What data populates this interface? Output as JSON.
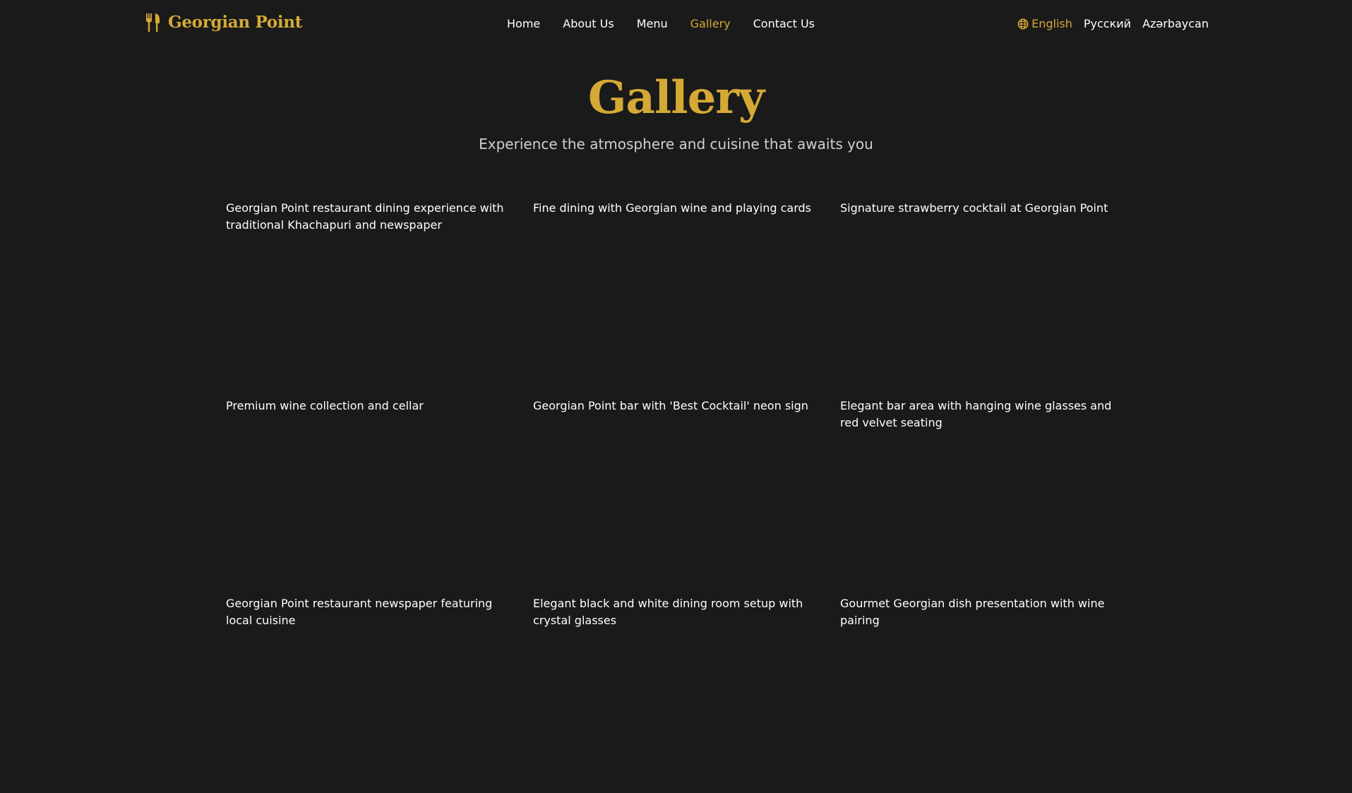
{
  "brand": {
    "name": "Georgian Point",
    "accent_color": "#d4a935",
    "icon": "fork-knife-icon"
  },
  "nav": {
    "items": [
      {
        "label": "Home",
        "active": false
      },
      {
        "label": "About Us",
        "active": false
      },
      {
        "label": "Menu",
        "active": false
      },
      {
        "label": "Gallery",
        "active": true
      },
      {
        "label": "Contact Us",
        "active": false
      }
    ]
  },
  "languages": {
    "icon": "globe-icon",
    "items": [
      {
        "label": "English",
        "active": true
      },
      {
        "label": "Русский",
        "active": false
      },
      {
        "label": "Azərbaycan",
        "active": false
      }
    ]
  },
  "hero": {
    "title": "Gallery",
    "subtitle": "Experience the atmosphere and cuisine that awaits you"
  },
  "gallery": {
    "items": [
      {
        "caption": "Georgian Point restaurant dining experience with traditional Khachapuri and newspaper"
      },
      {
        "caption": "Fine dining with Georgian wine and playing cards"
      },
      {
        "caption": "Signature strawberry cocktail at Georgian Point"
      },
      {
        "caption": "Premium wine collection and cellar"
      },
      {
        "caption": "Georgian Point bar with 'Best Cocktail' neon sign"
      },
      {
        "caption": "Elegant bar area with hanging wine glasses and red velvet seating"
      },
      {
        "caption": "Georgian Point restaurant newspaper featuring local cuisine"
      },
      {
        "caption": "Elegant black and white dining room setup with crystal glasses"
      },
      {
        "caption": "Gourmet Georgian dish presentation with wine pairing"
      }
    ]
  },
  "colors": {
    "background": "#1a1a1a",
    "accent": "#d4a935",
    "text": "#ffffff",
    "muted_text": "#cfcfcf"
  }
}
